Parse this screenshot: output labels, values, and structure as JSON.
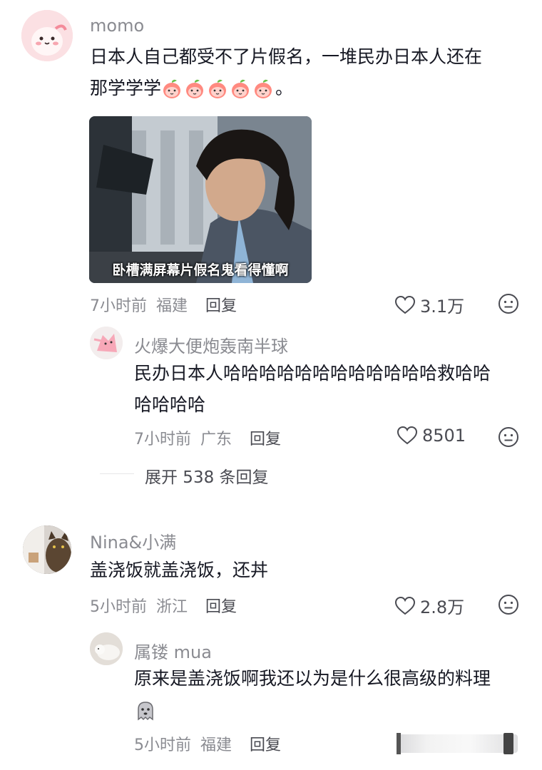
{
  "comments": [
    {
      "username": "momo",
      "text_line1": "日本人自己都受不了片假名，一堆民办日本人还在",
      "text_line2": "那学学学",
      "text_tail": "。",
      "emoji_count": 5,
      "image_caption": "卧槽满屏幕片假名鬼看得懂啊",
      "time": "7小时前",
      "location": "福建",
      "reply_label": "回复",
      "likes": "3.1万",
      "replies": [
        {
          "username": "火爆大便炮轰南半球",
          "text_line1": "民办日本人哈哈哈哈哈哈哈哈哈哈哈哈救哈哈",
          "text_line2": "哈哈哈哈",
          "time": "7小时前",
          "location": "广东",
          "reply_label": "回复",
          "likes": "8501"
        }
      ],
      "expand_label": "展开 538 条回复"
    },
    {
      "username": "Nina&小满",
      "text_line1": "盖浇饭就盖浇饭，还丼",
      "time": "5小时前",
      "location": "浙江",
      "reply_label": "回复",
      "likes": "2.8万",
      "replies": [
        {
          "username": "属镂 mua",
          "text_line1": "原来是盖浇饭啊我还以为是什么很高级的料理",
          "time": "5小时前",
          "location": "福建",
          "reply_label": "回复"
        }
      ]
    }
  ],
  "colors": {
    "text": "#161823",
    "meta": "#8a8b91",
    "icon": "#4a4b52",
    "peach": "#ff8a80"
  },
  "icons": [
    "heart-icon",
    "neutral-face-icon",
    "peach-emoji-icon",
    "ghost-emoji-icon"
  ]
}
